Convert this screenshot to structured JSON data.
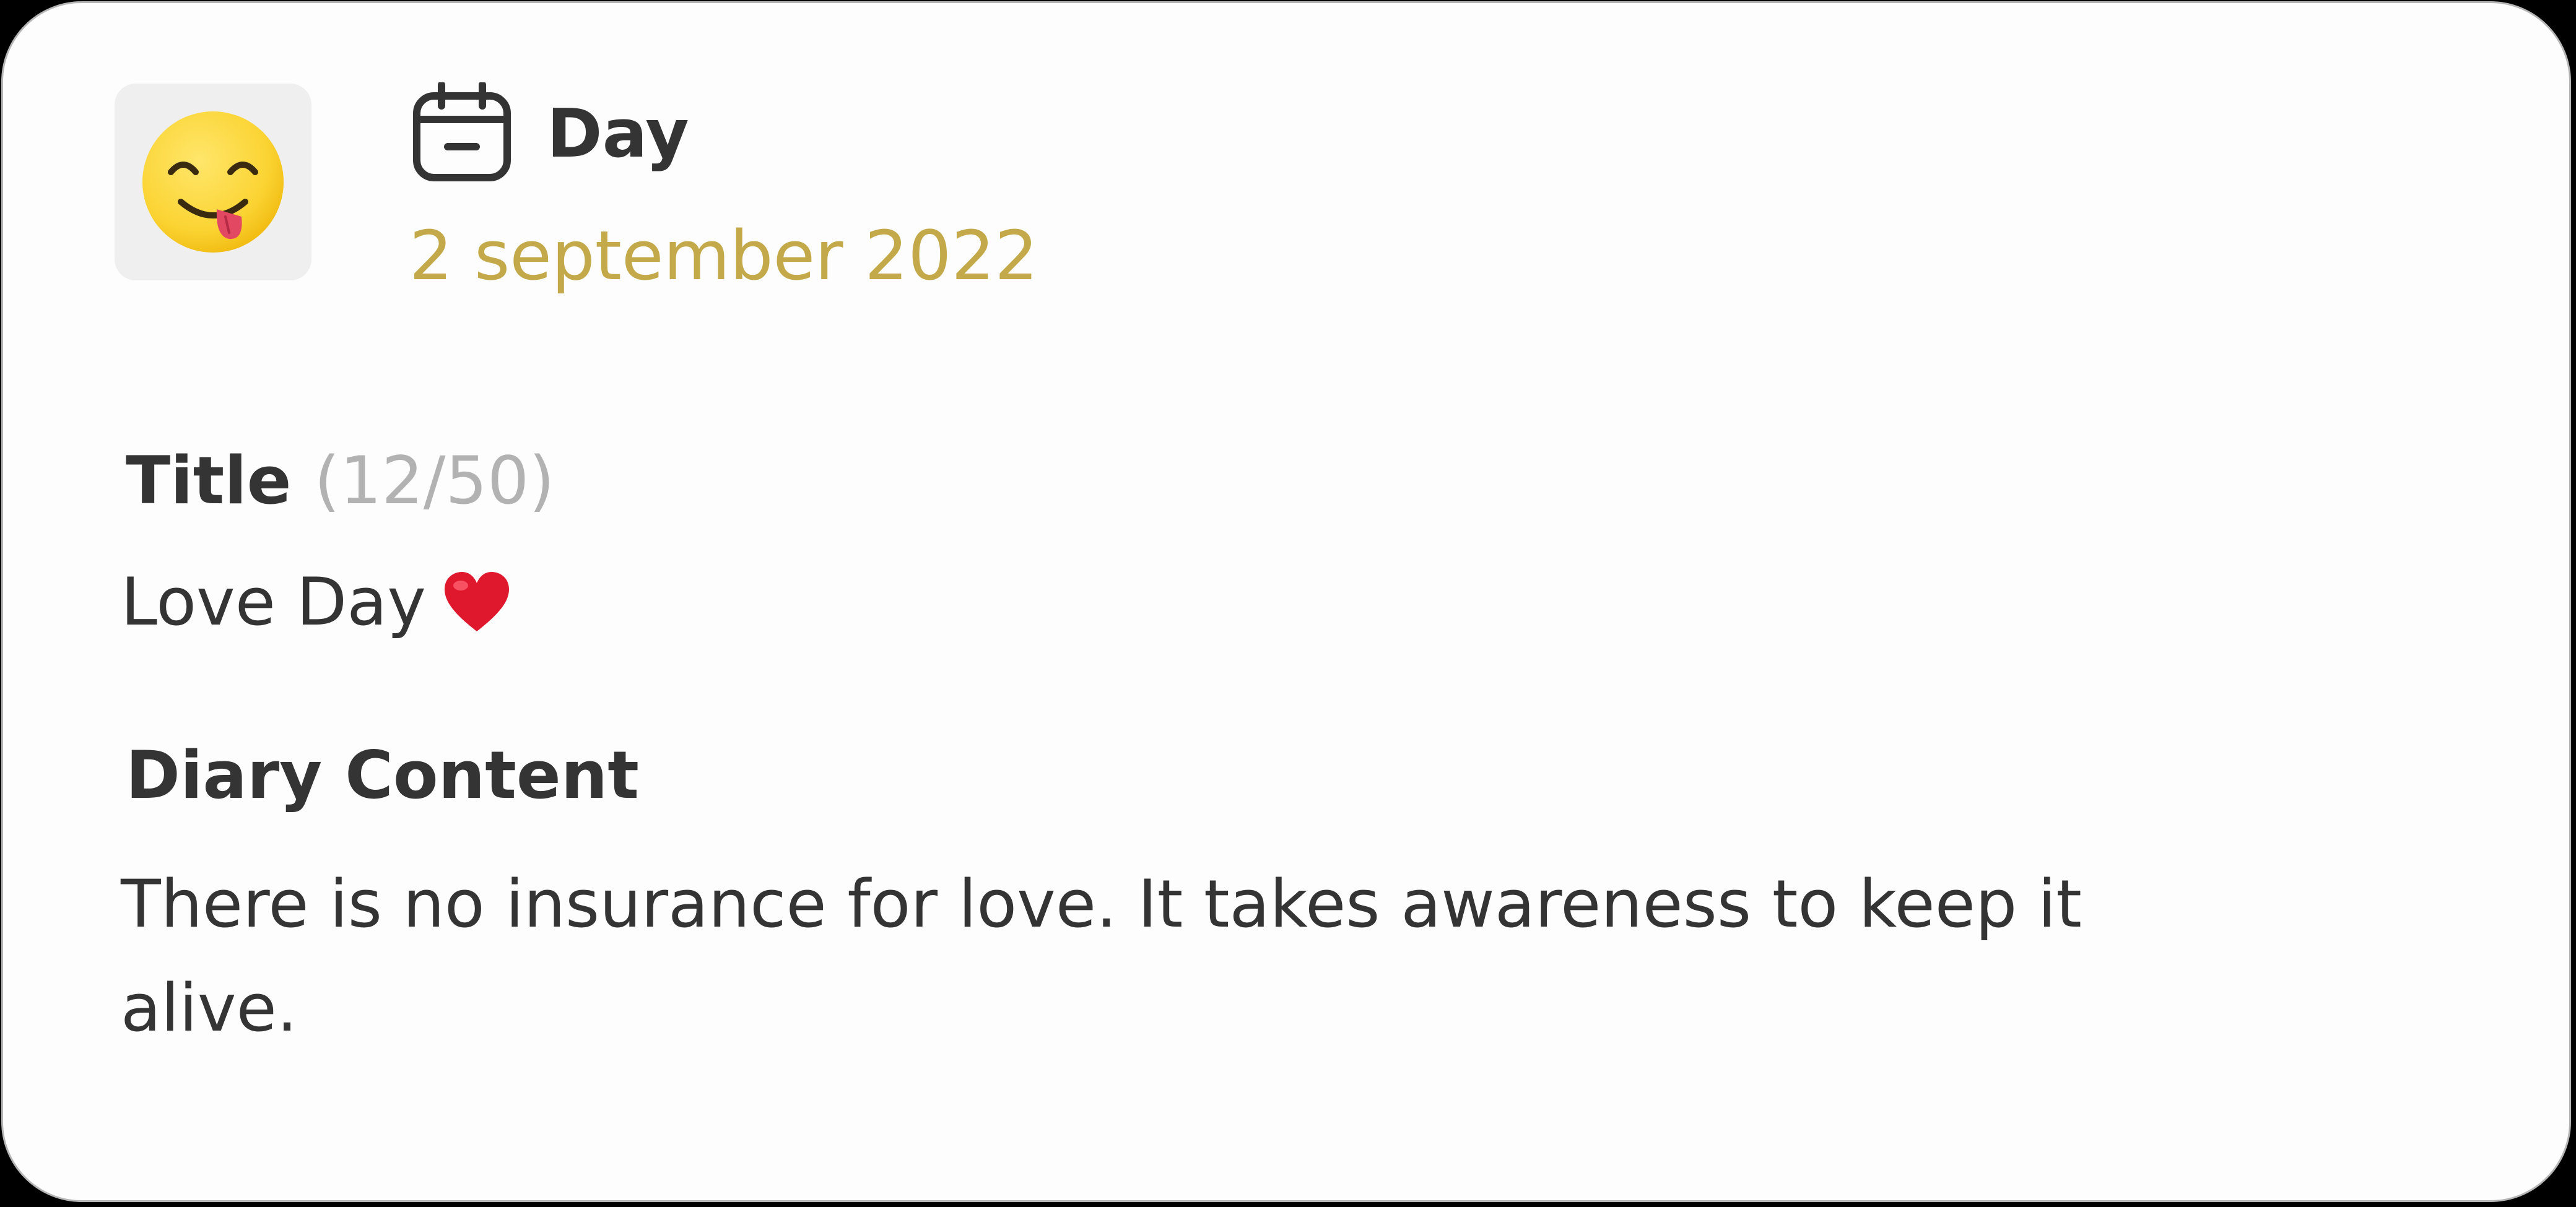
{
  "entry": {
    "mood_icon": "face-savoring-food-icon",
    "date_icon": "calendar-icon",
    "date_heading": "Day",
    "date": "2 september 2022",
    "title_label": "Title",
    "title_count": "(12/50)",
    "title_value": "Love Day",
    "title_emoji": "red-heart-icon",
    "content_label": "Diary Content",
    "content_value": "There is no insurance for love. It takes awareness to keep it alive."
  },
  "colors": {
    "accent_date": "#c4a94a",
    "text_primary": "#343434",
    "text_muted": "#b2b2b2",
    "card_background": "#fdfdfd",
    "tile_background": "#efefef"
  }
}
